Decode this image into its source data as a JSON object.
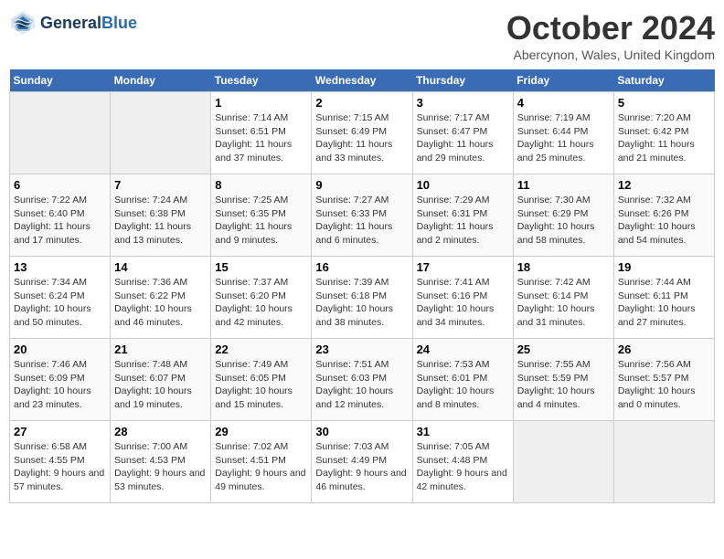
{
  "header": {
    "logo_line1": "General",
    "logo_line2": "Blue",
    "month": "October 2024",
    "location": "Abercynon, Wales, United Kingdom"
  },
  "days_of_week": [
    "Sunday",
    "Monday",
    "Tuesday",
    "Wednesday",
    "Thursday",
    "Friday",
    "Saturday"
  ],
  "weeks": [
    [
      {
        "day": "",
        "empty": true
      },
      {
        "day": "",
        "empty": true
      },
      {
        "day": "1",
        "sunrise": "Sunrise: 7:14 AM",
        "sunset": "Sunset: 6:51 PM",
        "daylight": "Daylight: 11 hours and 37 minutes."
      },
      {
        "day": "2",
        "sunrise": "Sunrise: 7:15 AM",
        "sunset": "Sunset: 6:49 PM",
        "daylight": "Daylight: 11 hours and 33 minutes."
      },
      {
        "day": "3",
        "sunrise": "Sunrise: 7:17 AM",
        "sunset": "Sunset: 6:47 PM",
        "daylight": "Daylight: 11 hours and 29 minutes."
      },
      {
        "day": "4",
        "sunrise": "Sunrise: 7:19 AM",
        "sunset": "Sunset: 6:44 PM",
        "daylight": "Daylight: 11 hours and 25 minutes."
      },
      {
        "day": "5",
        "sunrise": "Sunrise: 7:20 AM",
        "sunset": "Sunset: 6:42 PM",
        "daylight": "Daylight: 11 hours and 21 minutes."
      }
    ],
    [
      {
        "day": "6",
        "sunrise": "Sunrise: 7:22 AM",
        "sunset": "Sunset: 6:40 PM",
        "daylight": "Daylight: 11 hours and 17 minutes."
      },
      {
        "day": "7",
        "sunrise": "Sunrise: 7:24 AM",
        "sunset": "Sunset: 6:38 PM",
        "daylight": "Daylight: 11 hours and 13 minutes."
      },
      {
        "day": "8",
        "sunrise": "Sunrise: 7:25 AM",
        "sunset": "Sunset: 6:35 PM",
        "daylight": "Daylight: 11 hours and 9 minutes."
      },
      {
        "day": "9",
        "sunrise": "Sunrise: 7:27 AM",
        "sunset": "Sunset: 6:33 PM",
        "daylight": "Daylight: 11 hours and 6 minutes."
      },
      {
        "day": "10",
        "sunrise": "Sunrise: 7:29 AM",
        "sunset": "Sunset: 6:31 PM",
        "daylight": "Daylight: 11 hours and 2 minutes."
      },
      {
        "day": "11",
        "sunrise": "Sunrise: 7:30 AM",
        "sunset": "Sunset: 6:29 PM",
        "daylight": "Daylight: 10 hours and 58 minutes."
      },
      {
        "day": "12",
        "sunrise": "Sunrise: 7:32 AM",
        "sunset": "Sunset: 6:26 PM",
        "daylight": "Daylight: 10 hours and 54 minutes."
      }
    ],
    [
      {
        "day": "13",
        "sunrise": "Sunrise: 7:34 AM",
        "sunset": "Sunset: 6:24 PM",
        "daylight": "Daylight: 10 hours and 50 minutes."
      },
      {
        "day": "14",
        "sunrise": "Sunrise: 7:36 AM",
        "sunset": "Sunset: 6:22 PM",
        "daylight": "Daylight: 10 hours and 46 minutes."
      },
      {
        "day": "15",
        "sunrise": "Sunrise: 7:37 AM",
        "sunset": "Sunset: 6:20 PM",
        "daylight": "Daylight: 10 hours and 42 minutes."
      },
      {
        "day": "16",
        "sunrise": "Sunrise: 7:39 AM",
        "sunset": "Sunset: 6:18 PM",
        "daylight": "Daylight: 10 hours and 38 minutes."
      },
      {
        "day": "17",
        "sunrise": "Sunrise: 7:41 AM",
        "sunset": "Sunset: 6:16 PM",
        "daylight": "Daylight: 10 hours and 34 minutes."
      },
      {
        "day": "18",
        "sunrise": "Sunrise: 7:42 AM",
        "sunset": "Sunset: 6:14 PM",
        "daylight": "Daylight: 10 hours and 31 minutes."
      },
      {
        "day": "19",
        "sunrise": "Sunrise: 7:44 AM",
        "sunset": "Sunset: 6:11 PM",
        "daylight": "Daylight: 10 hours and 27 minutes."
      }
    ],
    [
      {
        "day": "20",
        "sunrise": "Sunrise: 7:46 AM",
        "sunset": "Sunset: 6:09 PM",
        "daylight": "Daylight: 10 hours and 23 minutes."
      },
      {
        "day": "21",
        "sunrise": "Sunrise: 7:48 AM",
        "sunset": "Sunset: 6:07 PM",
        "daylight": "Daylight: 10 hours and 19 minutes."
      },
      {
        "day": "22",
        "sunrise": "Sunrise: 7:49 AM",
        "sunset": "Sunset: 6:05 PM",
        "daylight": "Daylight: 10 hours and 15 minutes."
      },
      {
        "day": "23",
        "sunrise": "Sunrise: 7:51 AM",
        "sunset": "Sunset: 6:03 PM",
        "daylight": "Daylight: 10 hours and 12 minutes."
      },
      {
        "day": "24",
        "sunrise": "Sunrise: 7:53 AM",
        "sunset": "Sunset: 6:01 PM",
        "daylight": "Daylight: 10 hours and 8 minutes."
      },
      {
        "day": "25",
        "sunrise": "Sunrise: 7:55 AM",
        "sunset": "Sunset: 5:59 PM",
        "daylight": "Daylight: 10 hours and 4 minutes."
      },
      {
        "day": "26",
        "sunrise": "Sunrise: 7:56 AM",
        "sunset": "Sunset: 5:57 PM",
        "daylight": "Daylight: 10 hours and 0 minutes."
      }
    ],
    [
      {
        "day": "27",
        "sunrise": "Sunrise: 6:58 AM",
        "sunset": "Sunset: 4:55 PM",
        "daylight": "Daylight: 9 hours and 57 minutes."
      },
      {
        "day": "28",
        "sunrise": "Sunrise: 7:00 AM",
        "sunset": "Sunset: 4:53 PM",
        "daylight": "Daylight: 9 hours and 53 minutes."
      },
      {
        "day": "29",
        "sunrise": "Sunrise: 7:02 AM",
        "sunset": "Sunset: 4:51 PM",
        "daylight": "Daylight: 9 hours and 49 minutes."
      },
      {
        "day": "30",
        "sunrise": "Sunrise: 7:03 AM",
        "sunset": "Sunset: 4:49 PM",
        "daylight": "Daylight: 9 hours and 46 minutes."
      },
      {
        "day": "31",
        "sunrise": "Sunrise: 7:05 AM",
        "sunset": "Sunset: 4:48 PM",
        "daylight": "Daylight: 9 hours and 42 minutes."
      },
      {
        "day": "",
        "empty": true
      },
      {
        "day": "",
        "empty": true
      }
    ]
  ]
}
